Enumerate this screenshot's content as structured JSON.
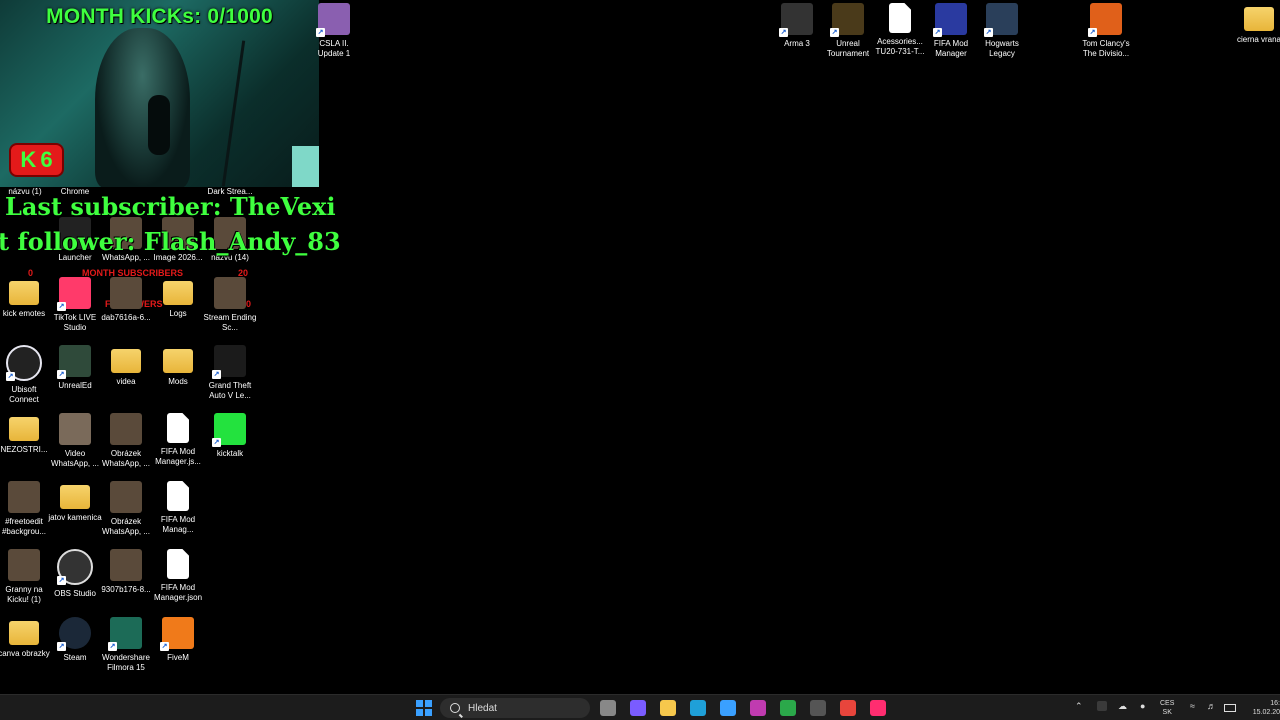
{
  "overlay": {
    "kicks_title": "MONTH KICKs: 0/1000",
    "kick_badge_letter": "K",
    "kick_badge_number": "6",
    "last_subscriber": "Last subscriber: TheVexi",
    "last_follower": "t follower: Flash_Andy_83",
    "month_subscribers": "MONTH SUBSCRIBERS",
    "subs_left": "0",
    "subs_right": "20",
    "followers_label": "FOLLOWERS",
    "followers_goal": "10000"
  },
  "top_icons": [
    {
      "label": "CSLA II. Update 1",
      "icon": "csla-icon",
      "color": "#8a5fb0"
    },
    {
      "label": "Arma 3",
      "icon": "arma-icon",
      "color": "#333333"
    },
    {
      "label": "Unreal Tournament",
      "icon": "unreal-tournament-icon",
      "color": "#4a3a1a"
    },
    {
      "label": "Acessories... TU20-731-T...",
      "icon": "file-icon",
      "color": "#ffffff"
    },
    {
      "label": "FIFA Mod Manager",
      "icon": "fifa-mod-manager-icon",
      "color": "#2a3aa0"
    },
    {
      "label": "Hogwarts Legacy",
      "icon": "hogwarts-icon",
      "color": "#2a3f5a"
    },
    {
      "label": "Tom Clancy's The Divisio...",
      "icon": "division-icon",
      "color": "#e0601a"
    },
    {
      "label": "cierna vrana",
      "icon": "folder-icon",
      "color": "#f6c84c"
    }
  ],
  "partial_labels": [
    "názvu (1)",
    "Chrome",
    "Dark Strea..."
  ],
  "row2_icons": [
    {
      "label": "Launcher",
      "icon": "epic-games-icon"
    },
    {
      "label": "WhatsApp, ...",
      "icon": "image-icon"
    },
    {
      "label": "Image 2026...",
      "icon": "image-icon"
    },
    {
      "label": "názvu (14)",
      "icon": "image-icon"
    }
  ],
  "grid_icons": [
    {
      "label": "kick emotes",
      "icon": "folder-icon"
    },
    {
      "label": "TikTok LIVE Studio",
      "icon": "tiktok-live-icon"
    },
    {
      "label": "dab7616a-6...",
      "icon": "image-icon"
    },
    {
      "label": "Logs",
      "icon": "folder-icon"
    },
    {
      "label": "Stream Ending Sc...",
      "icon": "image-icon"
    },
    {
      "label": "Ubisoft Connect",
      "icon": "ubisoft-icon"
    },
    {
      "label": "UnrealEd",
      "icon": "unreal-ed-icon"
    },
    {
      "label": "videa",
      "icon": "folder-icon"
    },
    {
      "label": "Mods",
      "icon": "folder-icon"
    },
    {
      "label": "Grand Theft Auto V Le...",
      "icon": "gta-v-icon"
    },
    {
      "label": "NEZOSTRI...",
      "icon": "folder-icon"
    },
    {
      "label": "Video WhatsApp, ...",
      "icon": "video-icon"
    },
    {
      "label": "Obrázek WhatsApp, ...",
      "icon": "image-icon"
    },
    {
      "label": "FIFA Mod Manager.js...",
      "icon": "file-icon"
    },
    {
      "label": "kicktalk",
      "icon": "kicktalk-icon"
    },
    {
      "label": "#freetoedit #backgrou...",
      "icon": "image-icon"
    },
    {
      "label": "jatov kamenica",
      "icon": "folder-icon"
    },
    {
      "label": "Obrázek WhatsApp, ...",
      "icon": "image-icon"
    },
    {
      "label": "FIFA Mod Manag...",
      "icon": "file-icon"
    },
    {
      "label": "Granny na Kicku! (1)",
      "icon": "image-icon"
    },
    {
      "label": "OBS Studio",
      "icon": "obs-icon"
    },
    {
      "label": "9307b176-8...",
      "icon": "image-icon"
    },
    {
      "label": "FIFA Mod Manager.json",
      "icon": "file-icon"
    },
    {
      "label": "canva obrazky",
      "icon": "folder-icon"
    },
    {
      "label": "Steam",
      "icon": "steam-icon"
    },
    {
      "label": "Wondershare Filmora 15",
      "icon": "filmora-icon"
    },
    {
      "label": "FiveM",
      "icon": "fivem-icon"
    }
  ],
  "taskbar": {
    "search_placeholder": "Hledat",
    "apps": [
      {
        "icon": "task-view-icon",
        "color": "#888888"
      },
      {
        "icon": "copilot-icon",
        "color": "#7a5cff"
      },
      {
        "icon": "file-explorer-icon",
        "color": "#f6c84c"
      },
      {
        "icon": "edge-icon",
        "color": "#1fa0d8"
      },
      {
        "icon": "store-icon",
        "color": "#3aa0ff"
      },
      {
        "icon": "app-icon",
        "color": "#c03bb0"
      },
      {
        "icon": "xbox-icon",
        "color": "#2ba84a"
      },
      {
        "icon": "obs-taskbar-icon",
        "color": "#555555"
      },
      {
        "icon": "chrome-icon",
        "color": "#e8453c"
      },
      {
        "icon": "tiktok-icon",
        "color": "#ff2d70"
      }
    ],
    "lang_top": "CES",
    "lang_bottom": "SK",
    "clock_time": "16:",
    "clock_date": "15.02.20"
  }
}
